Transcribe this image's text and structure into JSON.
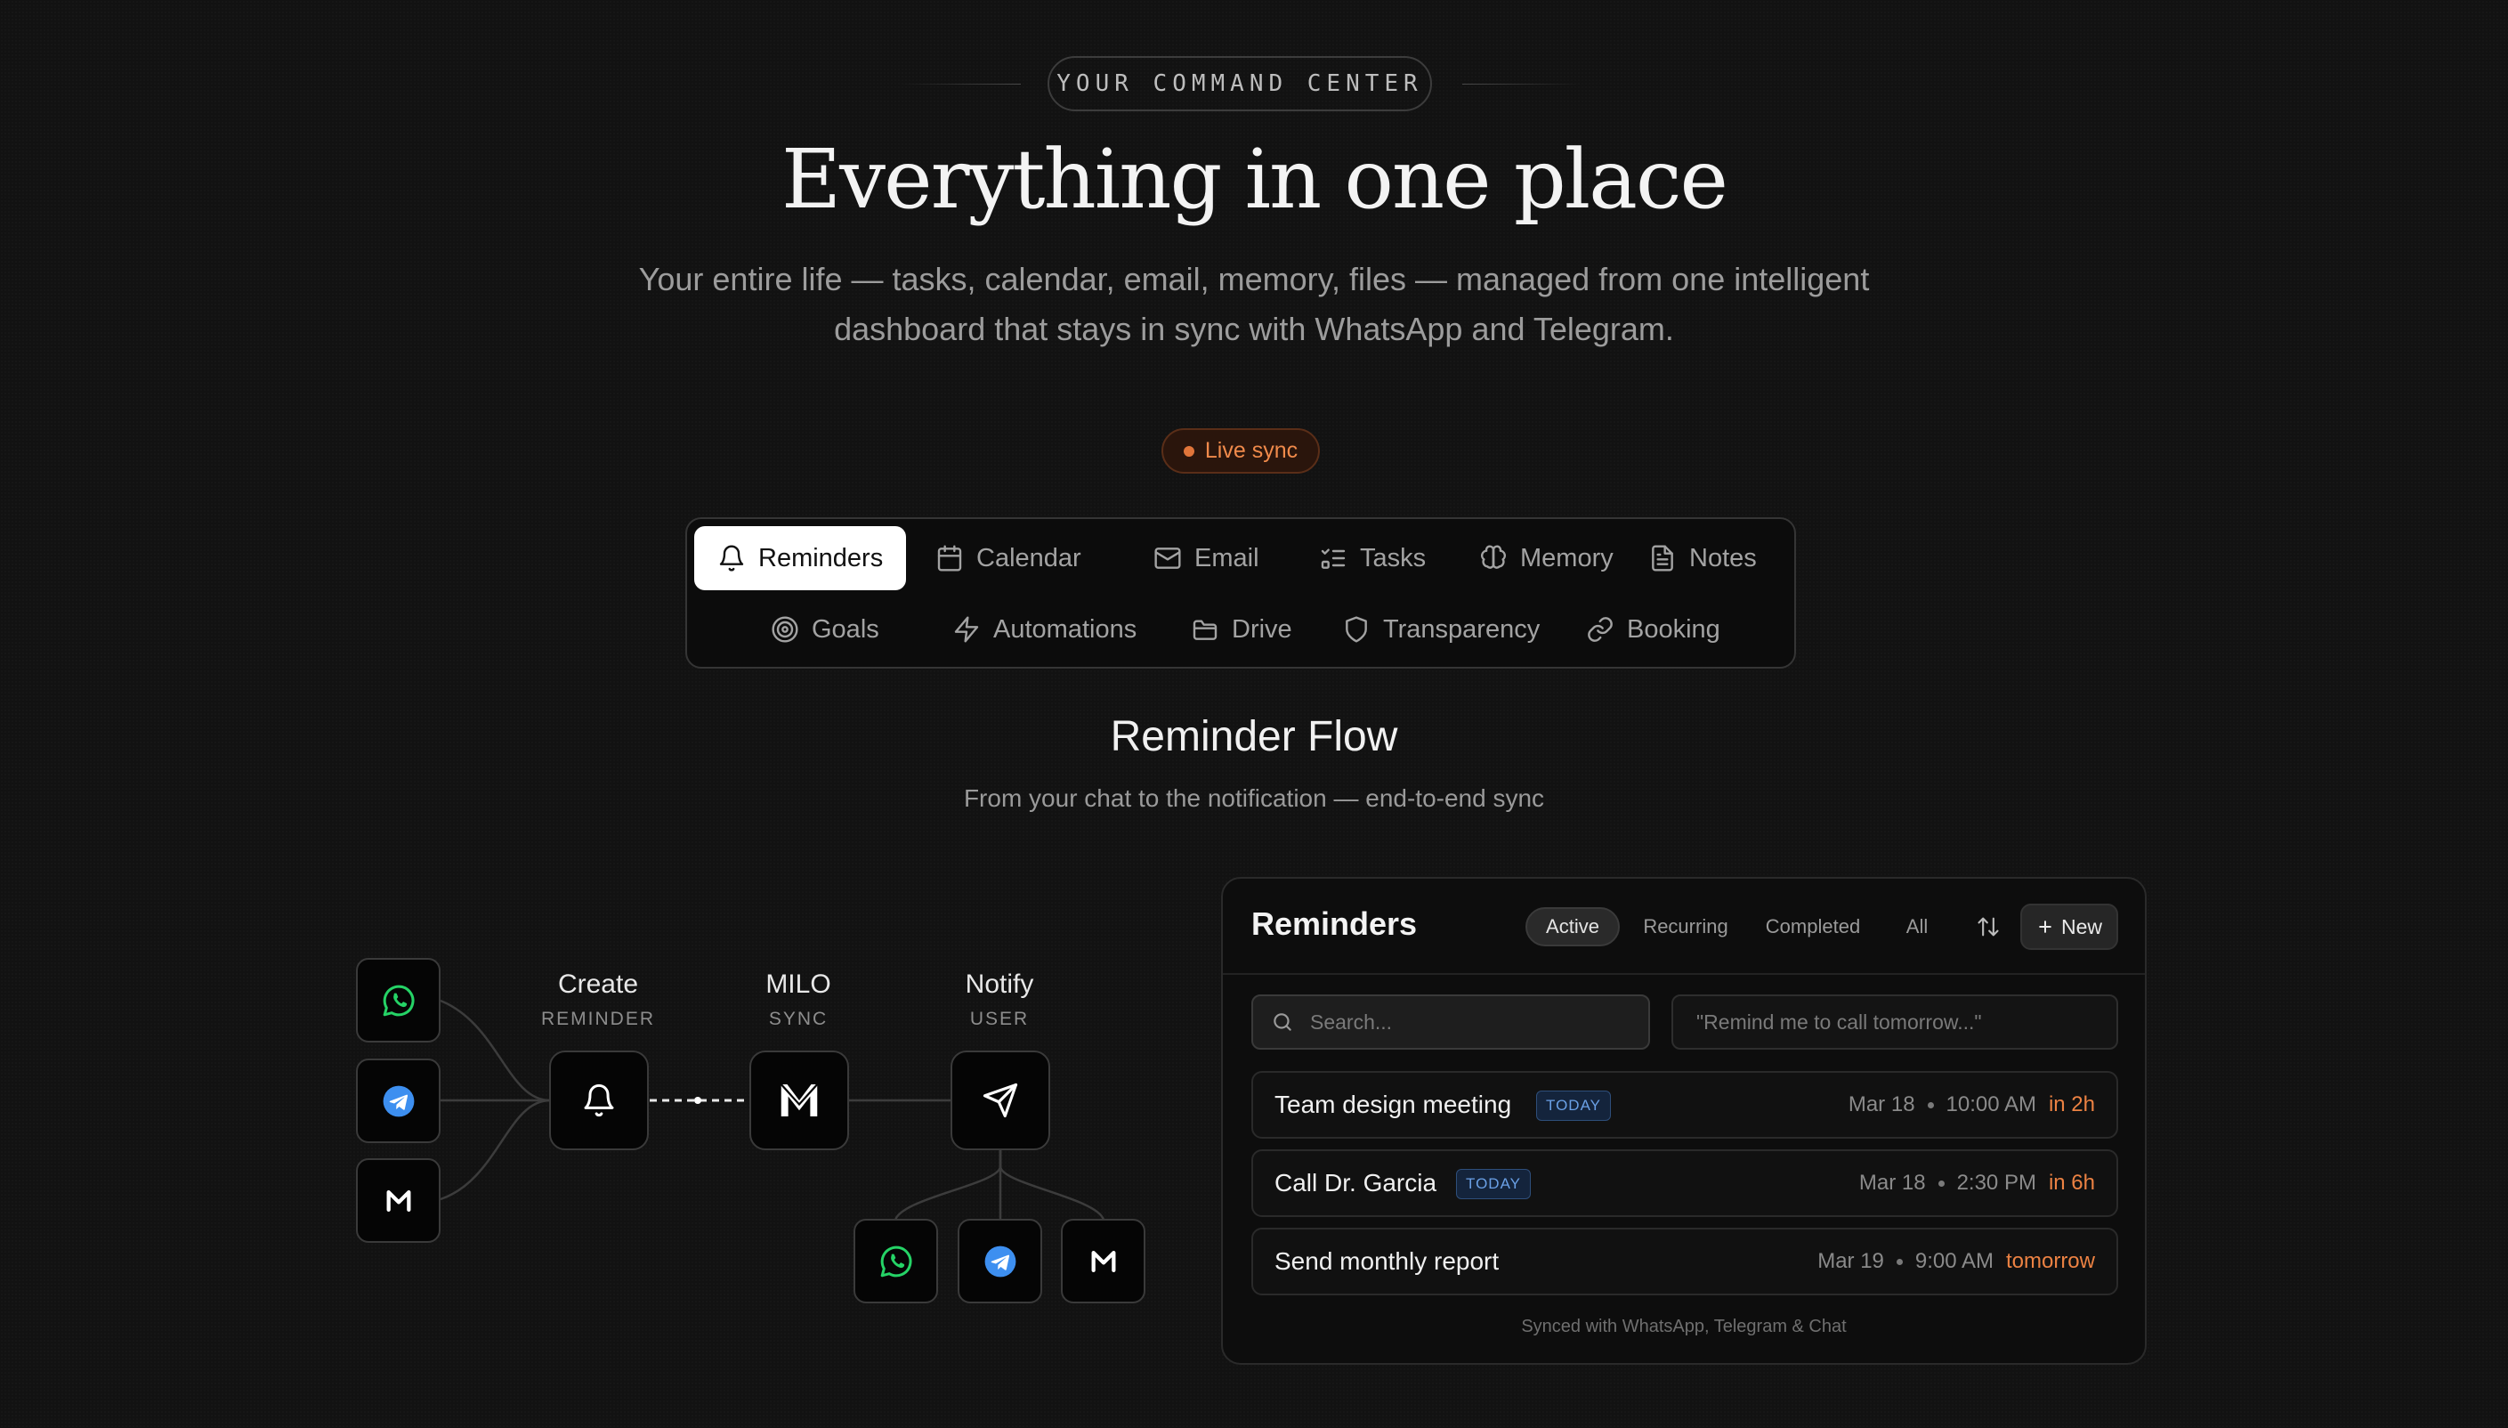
{
  "header": {
    "eyebrow": "YOUR COMMAND CENTER",
    "title": "Everything in one place",
    "subtitle": "Your entire life — tasks, calendar, email, memory, files — managed from one intelligent dashboard that stays in sync with WhatsApp and Telegram.",
    "live_badge": "Live sync"
  },
  "tabs": [
    {
      "label": "Reminders",
      "icon": "bell-icon",
      "active": true
    },
    {
      "label": "Calendar",
      "icon": "calendar-icon"
    },
    {
      "label": "Email",
      "icon": "mail-icon"
    },
    {
      "label": "Tasks",
      "icon": "list-check-icon"
    },
    {
      "label": "Memory",
      "icon": "brain-icon"
    },
    {
      "label": "Notes",
      "icon": "document-icon"
    },
    {
      "label": "Goals",
      "icon": "target-icon"
    },
    {
      "label": "Automations",
      "icon": "lightning-icon"
    },
    {
      "label": "Drive",
      "icon": "folder-icon"
    },
    {
      "label": "Transparency",
      "icon": "shield-icon"
    },
    {
      "label": "Booking",
      "icon": "link-icon"
    }
  ],
  "section": {
    "title": "Reminder Flow",
    "subtitle": "From your chat to the notification — end-to-end sync"
  },
  "flow": {
    "sources": [
      "whatsapp-icon",
      "telegram-icon",
      "milo-icon"
    ],
    "steps": [
      {
        "label": "Create",
        "sublabel": "REMINDER",
        "icon": "bell-icon"
      },
      {
        "label": "MILO",
        "sublabel": "SYNC",
        "icon": "milo-logo-icon"
      },
      {
        "label": "Notify",
        "sublabel": "USER",
        "icon": "send-icon"
      }
    ],
    "targets": [
      "whatsapp-icon",
      "telegram-icon",
      "milo-icon"
    ]
  },
  "panel": {
    "title": "Reminders",
    "filters": [
      "Active",
      "Recurring",
      "Completed",
      "All"
    ],
    "active_filter": "Active",
    "new_label": "New",
    "search_placeholder": "Search...",
    "quick_add_placeholder": "\"Remind me to call tomorrow...\"",
    "rows": [
      {
        "title": "Team design meeting",
        "badge": "TODAY",
        "date": "Mar 18",
        "time": "10:00 AM",
        "relative": "in 2h"
      },
      {
        "title": "Call Dr. Garcia",
        "badge": "TODAY",
        "date": "Mar 18",
        "time": "2:30 PM",
        "relative": "in 6h"
      },
      {
        "title": "Send monthly report",
        "badge": "",
        "date": "Mar 19",
        "time": "9:00 AM",
        "relative": "tomorrow"
      }
    ],
    "footer": "Synced with WhatsApp, Telegram & Chat"
  },
  "colors": {
    "accent_orange": "#ec8243",
    "whatsapp": "#25d366",
    "telegram": "#3d8ff0",
    "badge_blue": "#6aa0e6"
  }
}
